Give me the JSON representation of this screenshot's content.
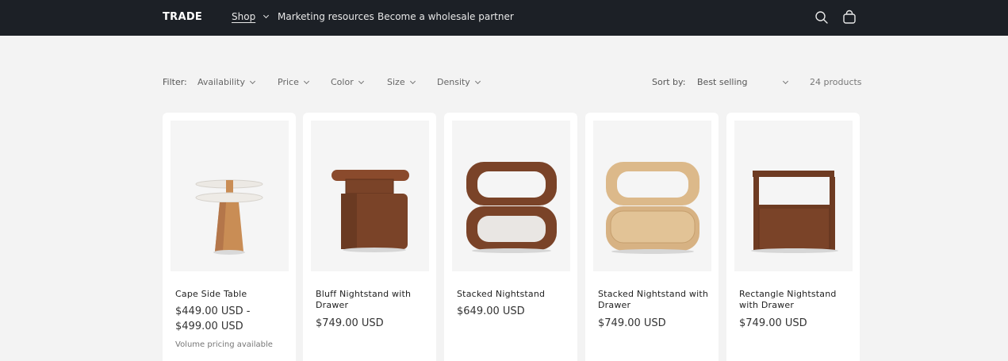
{
  "header": {
    "logo": "TRADE",
    "nav": [
      {
        "label": "Shop",
        "active": true
      },
      {
        "label": "Marketing resources"
      },
      {
        "label": "Become a wholesale partner"
      }
    ],
    "icons": [
      "search-icon",
      "cart-icon"
    ]
  },
  "filters": {
    "label": "Filter:",
    "items": [
      "Availability",
      "Price",
      "Color",
      "Size",
      "Density"
    ]
  },
  "sort": {
    "label": "Sort by:",
    "selected": "Best selling",
    "count": "24 products"
  },
  "products": [
    {
      "title": "Cape Side Table",
      "price_line1": "$449.00 USD -",
      "price_line2": "$499.00 USD",
      "note": "Volume pricing available"
    },
    {
      "title": "Bluff Nightstand with Drawer",
      "price": "$749.00 USD"
    },
    {
      "title": "Stacked Nightstand",
      "price": "$649.00 USD"
    },
    {
      "title": "Stacked Nightstand with Drawer",
      "price": "$749.00 USD"
    },
    {
      "title": "Rectangle Nightstand with Drawer",
      "price": "$749.00 USD"
    }
  ],
  "colors": {
    "header_bg": "#1c2026",
    "page_bg": "#f3f3f3",
    "walnut": "#7a4328",
    "oak": "#dcb98a"
  }
}
